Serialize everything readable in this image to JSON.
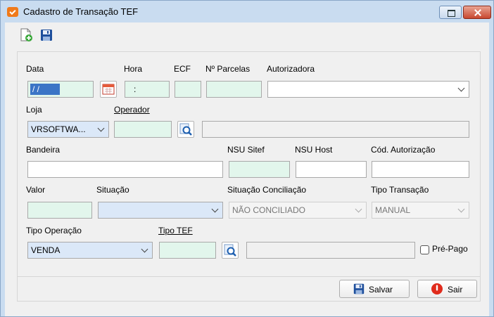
{
  "window": {
    "title": "Cadastro de Transação TEF"
  },
  "toolbar": {
    "new_icon": "new-document-icon",
    "save_icon": "floppy-disk-icon"
  },
  "form": {
    "data": {
      "label": "Data",
      "value": "/ /"
    },
    "hora": {
      "label": "Hora",
      "value": ":"
    },
    "ecf": {
      "label": "ECF",
      "value": ""
    },
    "parcelas": {
      "label": "Nº Parcelas",
      "value": ""
    },
    "autorizadora": {
      "label": "Autorizadora",
      "value": ""
    },
    "loja": {
      "label": "Loja",
      "value": "VRSOFTWA..."
    },
    "operador": {
      "label": "Operador",
      "value": "",
      "description": ""
    },
    "bandeira": {
      "label": "Bandeira",
      "value": ""
    },
    "nsu_sitef": {
      "label": "NSU Sitef",
      "value": ""
    },
    "nsu_host": {
      "label": "NSU Host",
      "value": ""
    },
    "cod_autorizacao": {
      "label": "Cód. Autorização",
      "value": ""
    },
    "valor": {
      "label": "Valor",
      "value": ""
    },
    "situacao": {
      "label": "Situação",
      "value": ""
    },
    "situacao_conciliacao": {
      "label": "Situação Conciliação",
      "value": "NÃO CONCILIADO"
    },
    "tipo_transacao": {
      "label": "Tipo Transação",
      "value": "MANUAL"
    },
    "tipo_operacao": {
      "label": "Tipo Operação",
      "value": "VENDA"
    },
    "tipo_tef": {
      "label": "Tipo TEF",
      "value": "",
      "description": ""
    },
    "pre_pago": {
      "label": "Pré-Pago",
      "checked": false
    }
  },
  "buttons": {
    "salvar": "Salvar",
    "sair": "Sair"
  },
  "colors": {
    "field_green": "#e2f6ec",
    "field_blue": "#dbe8f8",
    "selection": "#3b75c6",
    "window_frame": "#c9dcf0"
  }
}
